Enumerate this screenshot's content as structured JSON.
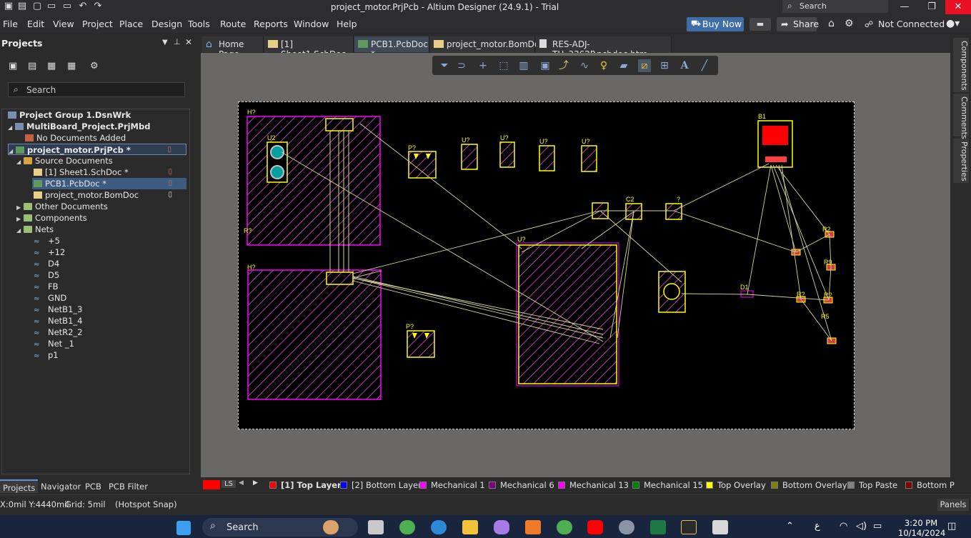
{
  "window": {
    "title": "project_motor.PrjPcb - Altium Designer (24.9.1) - Trial",
    "search_label": "Search"
  },
  "menu": [
    "File",
    "Edit",
    "View",
    "Project",
    "Place",
    "Design",
    "Tools",
    "Route",
    "Reports",
    "Window",
    "Help"
  ],
  "header_buttons": {
    "buy_now": "Buy Now",
    "share": "Share",
    "connection": "Not Connected"
  },
  "projects_panel": {
    "title": "Projects",
    "search_placeholder": "Search",
    "tree": [
      {
        "label": "Project Group 1.DsnWrk",
        "bold": true
      },
      {
        "label": "MultiBoard_Project.PrjMbd",
        "bold": true
      },
      {
        "label": "No Documents Added"
      },
      {
        "label": "project_motor.PrjPcb *",
        "bold": true
      },
      {
        "label": "Source Documents"
      },
      {
        "label": "[1] Sheet1.SchDoc *"
      },
      {
        "label": "PCB1.PcbDoc *"
      },
      {
        "label": "project_motor.BomDoc"
      },
      {
        "label": "Other Documents"
      },
      {
        "label": "Components"
      },
      {
        "label": "Nets"
      },
      {
        "label": "+5"
      },
      {
        "label": "+12"
      },
      {
        "label": "D4"
      },
      {
        "label": "D5"
      },
      {
        "label": "FB"
      },
      {
        "label": "GND"
      },
      {
        "label": "NetB1_3"
      },
      {
        "label": "NetB1_4"
      },
      {
        "label": "NetR2_2"
      },
      {
        "label": "Net _1"
      },
      {
        "label": "p1"
      }
    ],
    "bottom_tabs": [
      "Projects",
      "Navigator",
      "PCB",
      "PCB Filter"
    ]
  },
  "doc_tabs": [
    {
      "label": "Home Page"
    },
    {
      "label": "[1] Sheet1.SchDoc *"
    },
    {
      "label": "PCB1.PcbDoc *",
      "active": true
    },
    {
      "label": "project_motor.BomDoc"
    },
    {
      "label": "RES-ADJ-TH_3362P.pcbdoc.htm"
    }
  ],
  "right_panels": [
    "Components",
    "Comments",
    "Properties"
  ],
  "layer_bar": {
    "current": "LS",
    "layers": [
      {
        "label": "[1] Top Layer",
        "color": "#ff0000"
      },
      {
        "label": "[2] Bottom Layer",
        "color": "#0000ff"
      },
      {
        "label": "Mechanical 1",
        "color": "#ff00ff"
      },
      {
        "label": "Mechanical 6",
        "color": "#800080"
      },
      {
        "label": "Mechanical 13",
        "color": "#ff00ff"
      },
      {
        "label": "Mechanical 15",
        "color": "#008000"
      },
      {
        "label": "Top Overlay",
        "color": "#ffff00"
      },
      {
        "label": "Bottom Overlay",
        "color": "#808000"
      },
      {
        "label": "Top Paste",
        "color": "#808080"
      },
      {
        "label": "Bottom P",
        "color": "#800000"
      }
    ]
  },
  "designators": [
    "H?",
    "U2",
    "P?",
    "U?",
    "U?",
    "U?",
    "U?",
    "B1",
    "C2",
    "?",
    "R2",
    "R9",
    "R?",
    "R?",
    "R5",
    "D1",
    "U?",
    "H?",
    "R?",
    "P?"
  ],
  "status": {
    "coords": "X:0mil Y:4440mil",
    "grid": "Grid: 5mil",
    "snap": "(Hotspot Snap)",
    "panels": "Panels"
  },
  "taskbar": {
    "search": "Search",
    "time": "3:20 PM",
    "date": "10/14/2024",
    "lang": "ع"
  }
}
